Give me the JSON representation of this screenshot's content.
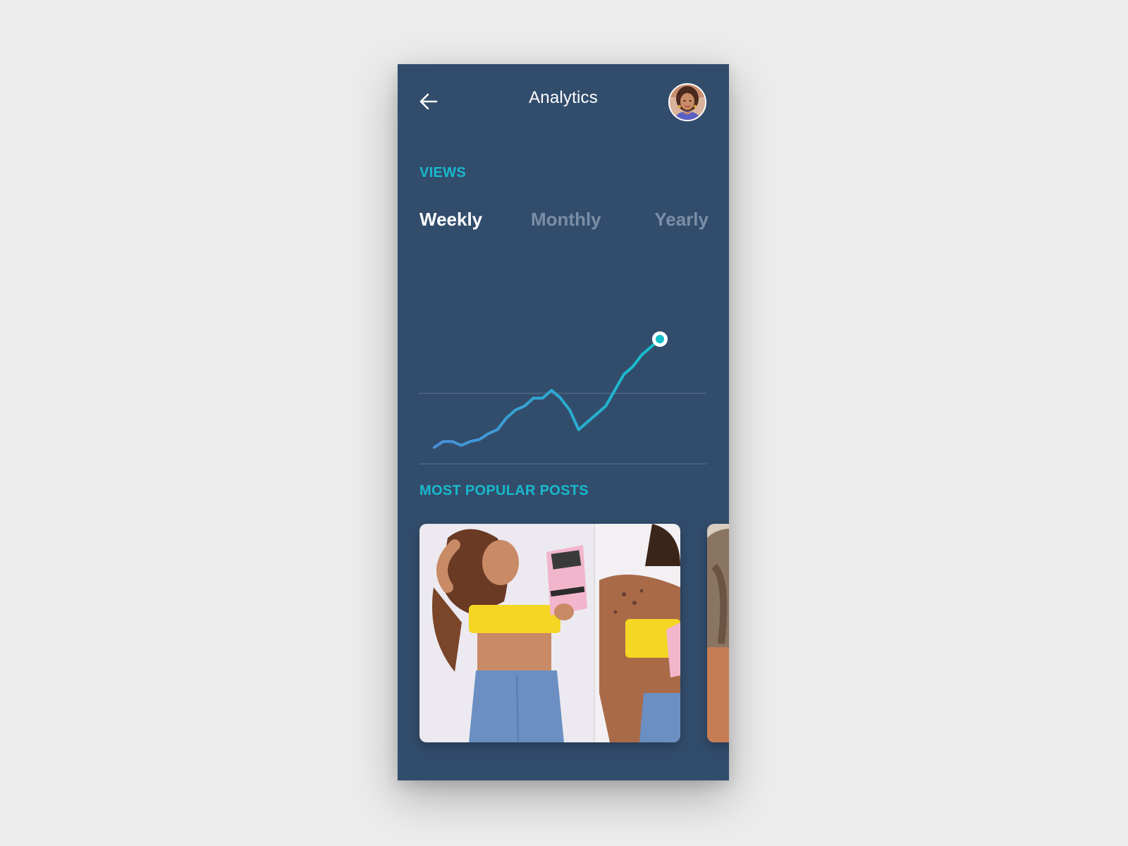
{
  "header": {
    "title": "Analytics",
    "back_icon": "arrow-left-icon",
    "avatar_icon": "user-avatar"
  },
  "views": {
    "label": "VIEWS",
    "tabs": [
      {
        "label": "Weekly",
        "active": true
      },
      {
        "label": "Monthly",
        "active": false
      },
      {
        "label": "Yearly",
        "active": false
      }
    ]
  },
  "chart_data": {
    "type": "line",
    "title": "",
    "xlabel": "",
    "ylabel": "",
    "grid": true,
    "series": [
      {
        "values": [
          1.5,
          3,
          3,
          2,
          3,
          3.5,
          5,
          6,
          9,
          11,
          12,
          14,
          14,
          16,
          14,
          11,
          6,
          8,
          10,
          12,
          16,
          20,
          22,
          25,
          27,
          29
        ]
      }
    ],
    "highlight": "last-point",
    "colors": {
      "line_start": "#4a90d9",
      "line_end": "#15bfcc",
      "grid": "#5a7491",
      "marker_fill": "#15bfcc",
      "marker_ring": "#ffffff"
    }
  },
  "popular": {
    "label": "MOST POPULAR POSTS",
    "posts": [
      {
        "icon": "post-photo-1"
      },
      {
        "icon": "post-photo-2"
      }
    ]
  },
  "colors": {
    "background": "#ececec",
    "panel": "#324d6c",
    "accent": "#18b9cc",
    "inactive_tab": "#7b8ea6"
  }
}
